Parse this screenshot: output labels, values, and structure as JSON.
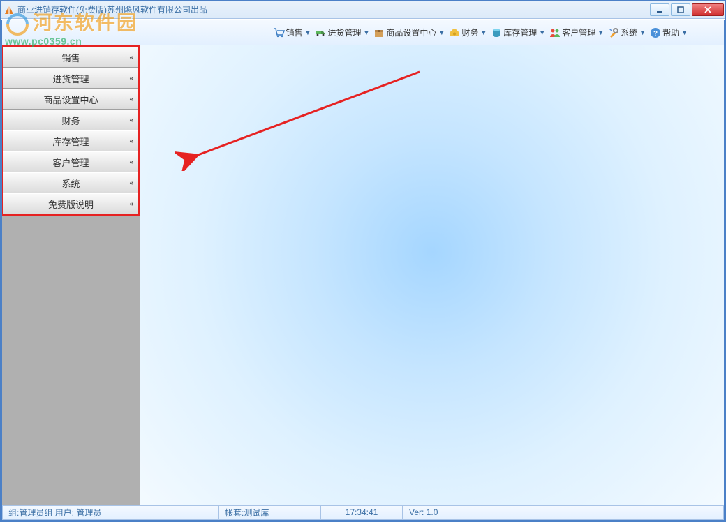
{
  "window": {
    "title": "商业进销存软件(免费版)苏州飚风软件有限公司出品"
  },
  "watermark": {
    "text": "河东软件园",
    "url": "www.pc0359.cn"
  },
  "toolbar": {
    "items": [
      {
        "label": "销售"
      },
      {
        "label": "进货管理"
      },
      {
        "label": "商品设置中心"
      },
      {
        "label": "财务"
      },
      {
        "label": "库存管理"
      },
      {
        "label": "客户管理"
      },
      {
        "label": "系统"
      },
      {
        "label": "帮助"
      }
    ]
  },
  "sidebar": {
    "items": [
      {
        "label": "销售"
      },
      {
        "label": "进货管理"
      },
      {
        "label": "商品设置中心"
      },
      {
        "label": "财务"
      },
      {
        "label": "库存管理"
      },
      {
        "label": "客户管理"
      },
      {
        "label": "系统"
      },
      {
        "label": "免费版说明"
      }
    ]
  },
  "statusbar": {
    "group_user": "组:管理员组 用户: 管理员",
    "account": "帐套:测试库",
    "time": "17:34:41",
    "version": "Ver: 1.0"
  }
}
